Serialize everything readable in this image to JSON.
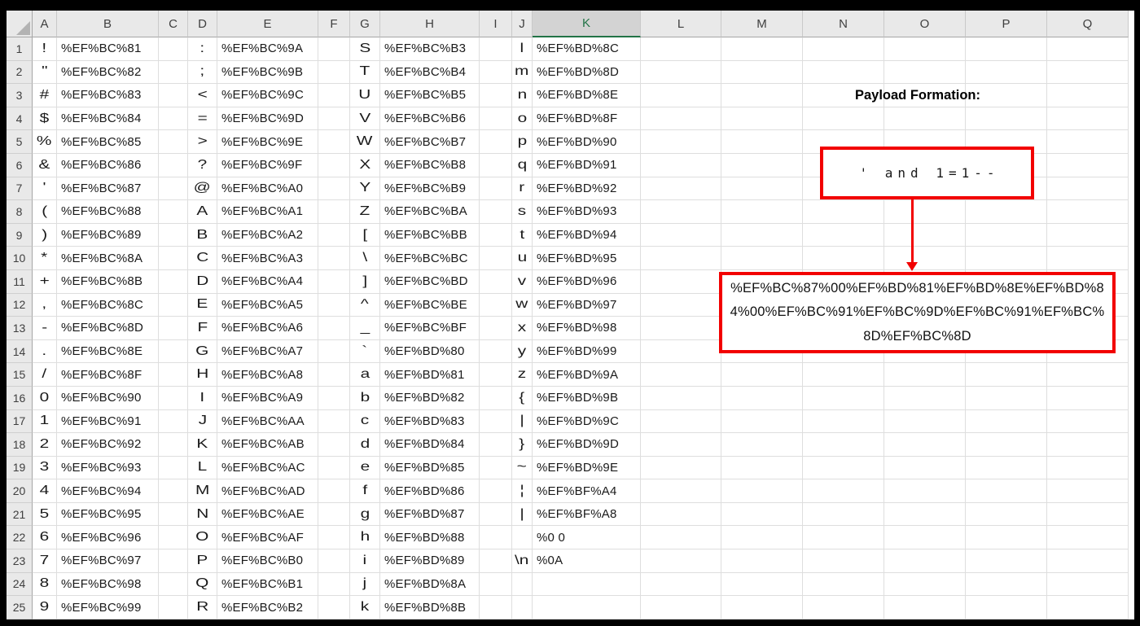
{
  "sheet": {
    "selected_column": "K",
    "columns": [
      "A",
      "B",
      "C",
      "D",
      "E",
      "F",
      "G",
      "H",
      "I",
      "J",
      "K",
      "L",
      "M",
      "N",
      "O",
      "P",
      "Q"
    ],
    "rows": [
      {
        "n": "1",
        "A": "!",
        "B": "%EF%BC%81",
        "D": ":",
        "E": "%EF%BC%9A",
        "G": "S",
        "H": "%EF%BC%B3",
        "J": "l",
        "K": "%EF%BD%8C"
      },
      {
        "n": "2",
        "A": "\"",
        "B": "%EF%BC%82",
        "D": ";",
        "E": "%EF%BC%9B",
        "G": "T",
        "H": "%EF%BC%B4",
        "J": "m",
        "K": "%EF%BD%8D"
      },
      {
        "n": "3",
        "A": "#",
        "B": "%EF%BC%83",
        "D": "<",
        "E": "%EF%BC%9C",
        "G": "U",
        "H": "%EF%BC%B5",
        "J": "n",
        "K": "%EF%BD%8E"
      },
      {
        "n": "4",
        "A": "$",
        "B": "%EF%BC%84",
        "D": "=",
        "E": "%EF%BC%9D",
        "G": "V",
        "H": "%EF%BC%B6",
        "J": "o",
        "K": "%EF%BD%8F"
      },
      {
        "n": "5",
        "A": "%",
        "B": "%EF%BC%85",
        "D": ">",
        "E": "%EF%BC%9E",
        "G": "W",
        "H": "%EF%BC%B7",
        "J": "p",
        "K": "%EF%BD%90"
      },
      {
        "n": "6",
        "A": "&",
        "B": "%EF%BC%86",
        "D": "?",
        "E": "%EF%BC%9F",
        "G": "X",
        "H": "%EF%BC%B8",
        "J": "q",
        "K": "%EF%BD%91"
      },
      {
        "n": "7",
        "A": "'",
        "B": "%EF%BC%87",
        "D": "@",
        "E": "%EF%BC%A0",
        "G": "Y",
        "H": "%EF%BC%B9",
        "J": "r",
        "K": "%EF%BD%92"
      },
      {
        "n": "8",
        "A": "(",
        "B": "%EF%BC%88",
        "D": "A",
        "E": "%EF%BC%A1",
        "G": "Z",
        "H": "%EF%BC%BA",
        "J": "s",
        "K": "%EF%BD%93"
      },
      {
        "n": "9",
        "A": ")",
        "B": "%EF%BC%89",
        "D": "B",
        "E": "%EF%BC%A2",
        "G": "[",
        "H": "%EF%BC%BB",
        "J": "t",
        "K": "%EF%BD%94"
      },
      {
        "n": "10",
        "A": "*",
        "B": "%EF%BC%8A",
        "D": "C",
        "E": "%EF%BC%A3",
        "G": "\\",
        "H": "%EF%BC%BC",
        "J": "u",
        "K": "%EF%BD%95"
      },
      {
        "n": "11",
        "A": "+",
        "B": "%EF%BC%8B",
        "D": "D",
        "E": "%EF%BC%A4",
        "G": "]",
        "H": "%EF%BC%BD",
        "J": "v",
        "K": "%EF%BD%96"
      },
      {
        "n": "12",
        "A": ",",
        "B": "%EF%BC%8C",
        "D": "E",
        "E": "%EF%BC%A5",
        "G": "^",
        "H": "%EF%BC%BE",
        "J": "w",
        "K": "%EF%BD%97"
      },
      {
        "n": "13",
        "A": "-",
        "B": "%EF%BC%8D",
        "D": "F",
        "E": "%EF%BC%A6",
        "G": "_",
        "H": "%EF%BC%BF",
        "J": "x",
        "K": "%EF%BD%98"
      },
      {
        "n": "14",
        "A": ".",
        "B": "%EF%BC%8E",
        "D": "G",
        "E": "%EF%BC%A7",
        "G": "`",
        "H": "%EF%BD%80",
        "J": "y",
        "K": "%EF%BD%99"
      },
      {
        "n": "15",
        "A": "/",
        "B": "%EF%BC%8F",
        "D": "H",
        "E": "%EF%BC%A8",
        "G": "a",
        "H": "%EF%BD%81",
        "J": "z",
        "K": "%EF%BD%9A"
      },
      {
        "n": "16",
        "A": "0",
        "B": "%EF%BC%90",
        "D": "I",
        "E": "%EF%BC%A9",
        "G": "b",
        "H": "%EF%BD%82",
        "J": "{",
        "K": "%EF%BD%9B"
      },
      {
        "n": "17",
        "A": "1",
        "B": "%EF%BC%91",
        "D": "J",
        "E": "%EF%BC%AA",
        "G": "c",
        "H": "%EF%BD%83",
        "J": "|",
        "K": "%EF%BD%9C"
      },
      {
        "n": "18",
        "A": "2",
        "B": "%EF%BC%92",
        "D": "K",
        "E": "%EF%BC%AB",
        "G": "d",
        "H": "%EF%BD%84",
        "J": "}",
        "K": "%EF%BD%9D"
      },
      {
        "n": "19",
        "A": "3",
        "B": "%EF%BC%93",
        "D": "L",
        "E": "%EF%BC%AC",
        "G": "e",
        "H": "%EF%BD%85",
        "J": "~",
        "K": "%EF%BD%9E"
      },
      {
        "n": "20",
        "A": "4",
        "B": "%EF%BC%94",
        "D": "M",
        "E": "%EF%BC%AD",
        "G": "f",
        "H": "%EF%BD%86",
        "J": "¦",
        "K": "%EF%BF%A4"
      },
      {
        "n": "21",
        "A": "5",
        "B": "%EF%BC%95",
        "D": "N",
        "E": "%EF%BC%AE",
        "G": "g",
        "H": "%EF%BD%87",
        "J": "|",
        "K": "%EF%BF%A8"
      },
      {
        "n": "22",
        "A": "6",
        "B": "%EF%BC%96",
        "D": "O",
        "E": "%EF%BC%AF",
        "G": "h",
        "H": "%EF%BD%88",
        "J": "",
        "K": "%0 0"
      },
      {
        "n": "23",
        "A": "7",
        "B": "%EF%BC%97",
        "D": "P",
        "E": "%EF%BC%B0",
        "G": "i",
        "H": "%EF%BD%89",
        "J": "\\n",
        "K": "%0A"
      },
      {
        "n": "24",
        "A": "8",
        "B": "%EF%BC%98",
        "D": "Q",
        "E": "%EF%BC%B1",
        "G": "j",
        "H": "%EF%BD%8A",
        "J": "",
        "K": ""
      },
      {
        "n": "25",
        "A": "9",
        "B": "%EF%BC%99",
        "D": "R",
        "E": "%EF%BC%B2",
        "G": "k",
        "H": "%EF%BD%8B",
        "J": "",
        "K": ""
      }
    ]
  },
  "annotations": {
    "title": "Payload Formation:",
    "source_payload": "' and 1=1--",
    "payload_lines": [
      "%EF%BC%87%00%EF%BD%81%EF%BD%8E%EF%BD%8",
      "4%00%EF%BC%91%EF%BC%9D%EF%BC%91%EF%BC%",
      "8D%EF%BC%8D"
    ],
    "colors": {
      "accent_red": "#f20000",
      "excel_green": "#217346"
    }
  }
}
